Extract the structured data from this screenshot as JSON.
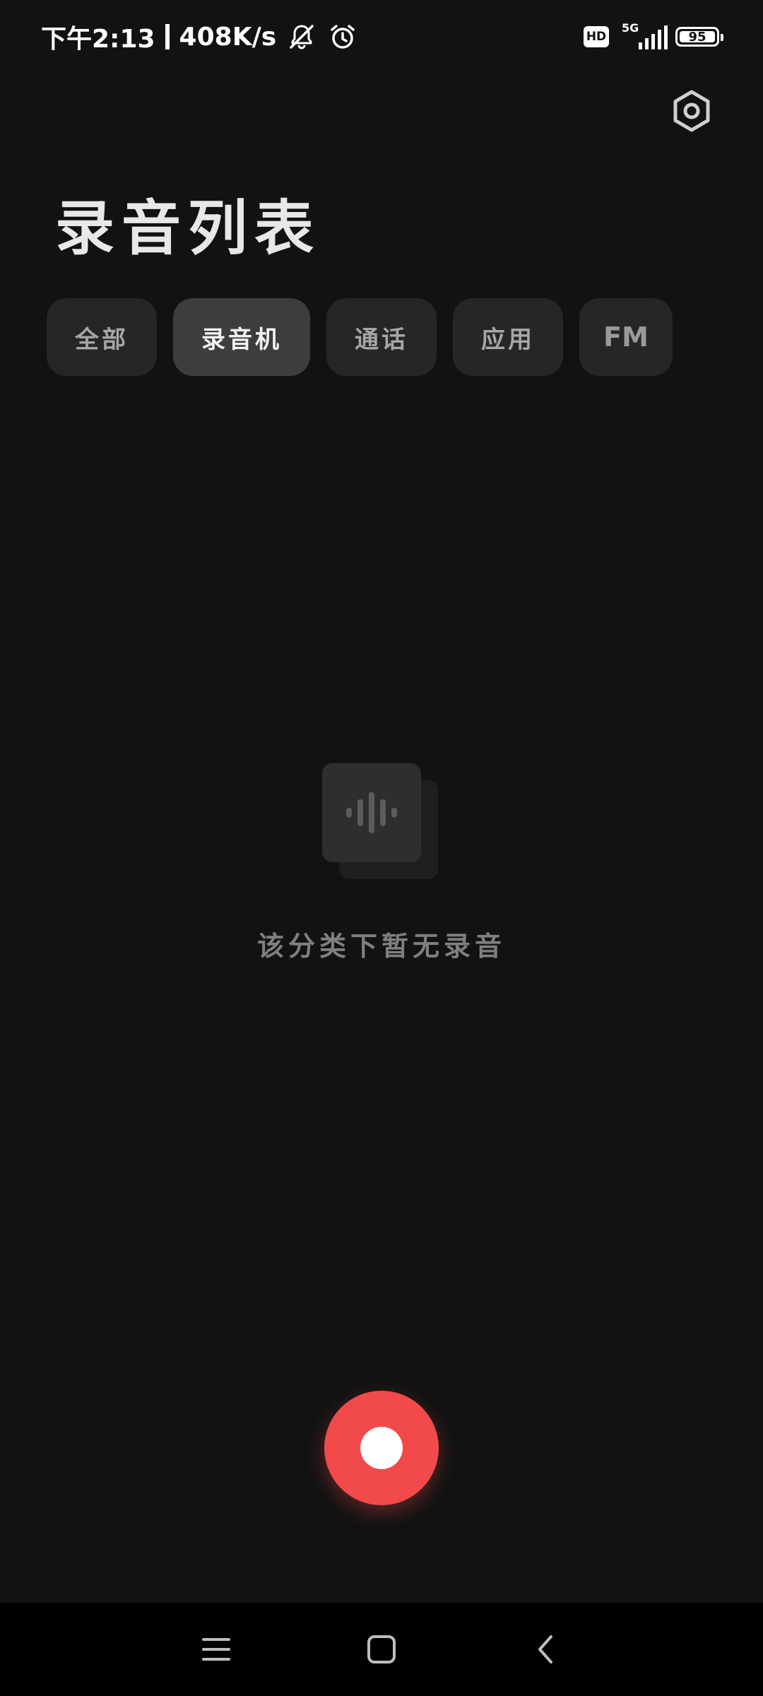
{
  "status_bar": {
    "time": "下午2:13",
    "net_speed": "408K/s",
    "hd_label": "HD",
    "network_type": "5G",
    "battery_level": "95",
    "icons": [
      "notifications-muted-icon",
      "alarm-icon",
      "hd-icon",
      "signal-icon",
      "battery-icon"
    ]
  },
  "header": {
    "title": "录音列表",
    "settings_icon": "settings-hex-icon"
  },
  "tabs": [
    {
      "label": "全部",
      "active": false
    },
    {
      "label": "录音机",
      "active": true
    },
    {
      "label": "通话",
      "active": false
    },
    {
      "label": "应用",
      "active": false
    },
    {
      "label": "FM",
      "active": false
    }
  ],
  "empty_state": {
    "icon": "waveform-icon",
    "message": "该分类下暂无录音"
  },
  "record_button": {
    "icon": "record-icon",
    "color": "#f24a4a"
  },
  "nav_bar": {
    "icons": [
      "menu-icon",
      "home-icon",
      "back-icon"
    ]
  },
  "colors": {
    "background": "#121212",
    "tab_bg": "#262626",
    "tab_active_bg": "#3d3d3d",
    "accent_red": "#f24a4a"
  }
}
